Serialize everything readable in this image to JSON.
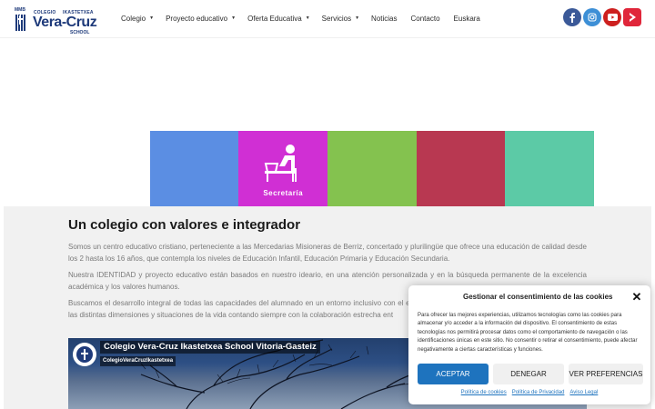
{
  "header": {
    "logo": {
      "mark_text": "MMB",
      "colegio": "COLEGIO",
      "ikastetxea": "IKASTETXEA",
      "name": "Vera-Cruz",
      "school": "SCHOOL"
    },
    "nav": [
      {
        "label": "Colegio",
        "has_dropdown": true
      },
      {
        "label": "Proyecto educativo",
        "has_dropdown": true
      },
      {
        "label": "Oferta Educativa",
        "has_dropdown": true
      },
      {
        "label": "Servicios",
        "has_dropdown": true
      },
      {
        "label": "Noticias",
        "has_dropdown": false
      },
      {
        "label": "Contacto",
        "has_dropdown": false
      },
      {
        "label": "Euskara",
        "has_dropdown": false
      }
    ],
    "caret": "▼",
    "social": [
      {
        "icon": "facebook-icon",
        "color": "#3b5998"
      },
      {
        "icon": "instagram-icon",
        "color": "#3d8fd6"
      },
      {
        "icon": "youtube-icon",
        "color": "#cd201f"
      },
      {
        "icon": "ivoox-icon",
        "color": "#e0263a"
      }
    ]
  },
  "banner": {
    "tile_colors": [
      "#ffffff",
      "#5b8ee3",
      "#d02fd4",
      "#84c24f",
      "#b83851",
      "#5ccaa6"
    ],
    "highlight_label": "Secretaría"
  },
  "main": {
    "heading": "Un colegio con valores e integrador",
    "paragraphs": [
      "Somos un centro educativo cristiano, perteneciente a las Mercedarias Misioneras de Berriz, concertado y plurilingüe que ofrece una educación de calidad desde los 2 hasta los 16 años, que contempla los niveles de Educación Infantil, Educación Primaria y Educación Secundaria.",
      "Nuestra IDENTIDAD y proyecto educativo están basados en nuestro ideario, en una atención personalizada y en la búsqueda permanente de la excelencia académica y los valores humanos.",
      "Buscamos el desarrollo integral de todas las capacidades del alumnado en un entorno inclusivo con el en las distintas dimensiones y situaciones de la vida contando siempre con la colaboración estrecha ent"
    ]
  },
  "video": {
    "title": "Colegio Vera-Cruz Ikastetxea School Vitoria-Gasteiz",
    "channel": "ColegioVeraCruzIkastetxea"
  },
  "cookie": {
    "title": "Gestionar el consentimiento de las cookies",
    "close": "✕",
    "body": "Para ofrecer las mejores experiencias, utilizamos tecnologías como las cookies para almacenar y/o acceder a la información del dispositivo. El consentimiento de estas tecnologías nos permitirá procesar datos como el comportamiento de navegación o las identificaciones únicas en este sitio. No consentir o retirar el consentimiento, puede afectar negativamente a ciertas características y funciones.",
    "accept": "ACEPTAR",
    "deny": "DENEGAR",
    "preferences": "VER PREFERENCIAS",
    "links": [
      "Política de cookies",
      "Política de Privacidad",
      "Aviso Legal"
    ]
  }
}
